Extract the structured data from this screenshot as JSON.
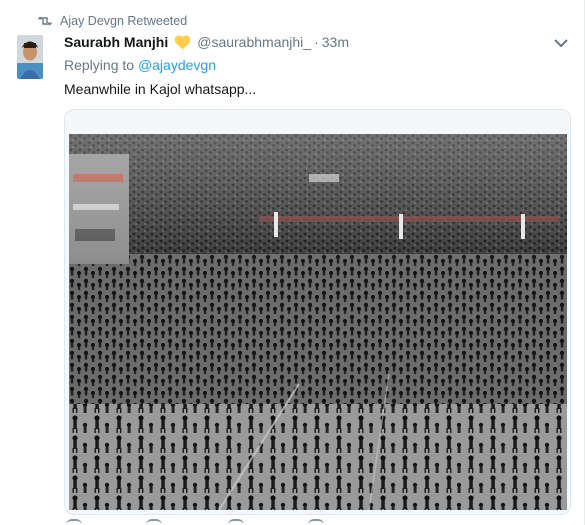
{
  "retweet": {
    "label": "Ajay Devgn Retweeted",
    "icon": "retweet-icon"
  },
  "author": {
    "name": "Saurabh Manjhi",
    "emoji": "yellow-heart-icon",
    "handle": "@saurabhmanjhi_",
    "separator": "·",
    "time": "33m"
  },
  "reply": {
    "prefix": "Replying to",
    "mention": "@ajaydevgn"
  },
  "tweet_text": "Meanwhile in Kajol whatsapp...",
  "media": {
    "description_icon": "crowd-photo"
  },
  "colors": {
    "link": "#1da1f2",
    "muted": "#657786",
    "text": "#14171a",
    "heart": "#ffcc4d"
  }
}
